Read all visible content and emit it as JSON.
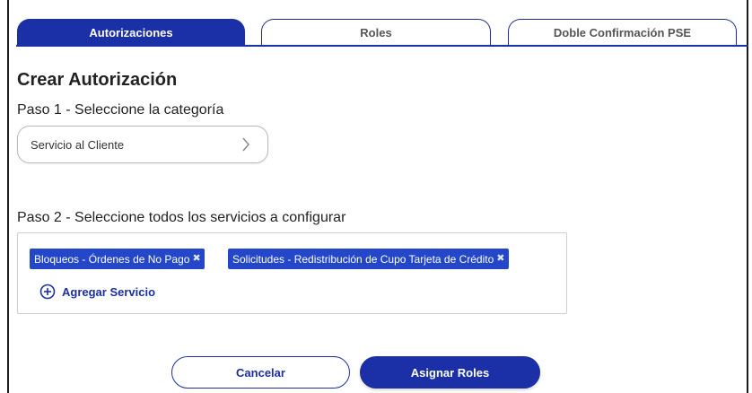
{
  "tabs": [
    {
      "label": "Autorizaciones",
      "active": true
    },
    {
      "label": "Roles",
      "active": false
    },
    {
      "label": "Doble Confirmación PSE",
      "active": false
    }
  ],
  "page": {
    "title": "Crear Autorización"
  },
  "step1": {
    "label": "Paso 1 - Seleccione la categoría",
    "selected_category": "Servicio al Cliente",
    "icon": "chevron-right-icon"
  },
  "step2": {
    "label": "Paso 2 - Seleccione todos los servicios a configurar",
    "services": [
      {
        "label": "Bloqueos - Órdenes de No Pago",
        "remove_icon": "close-icon"
      },
      {
        "label": "Solicitudes - Redistribución de Cupo Tarjeta de Crédito",
        "remove_icon": "close-icon"
      }
    ],
    "add_service_label": "Agregar Servicio",
    "add_icon": "plus-circle-icon"
  },
  "actions": {
    "cancel_label": "Cancelar",
    "assign_label": "Asignar Roles"
  },
  "colors": {
    "primary": "#1b2fa6",
    "chip": "#2447c9",
    "text": "#222222",
    "border": "#cfcfcf"
  }
}
